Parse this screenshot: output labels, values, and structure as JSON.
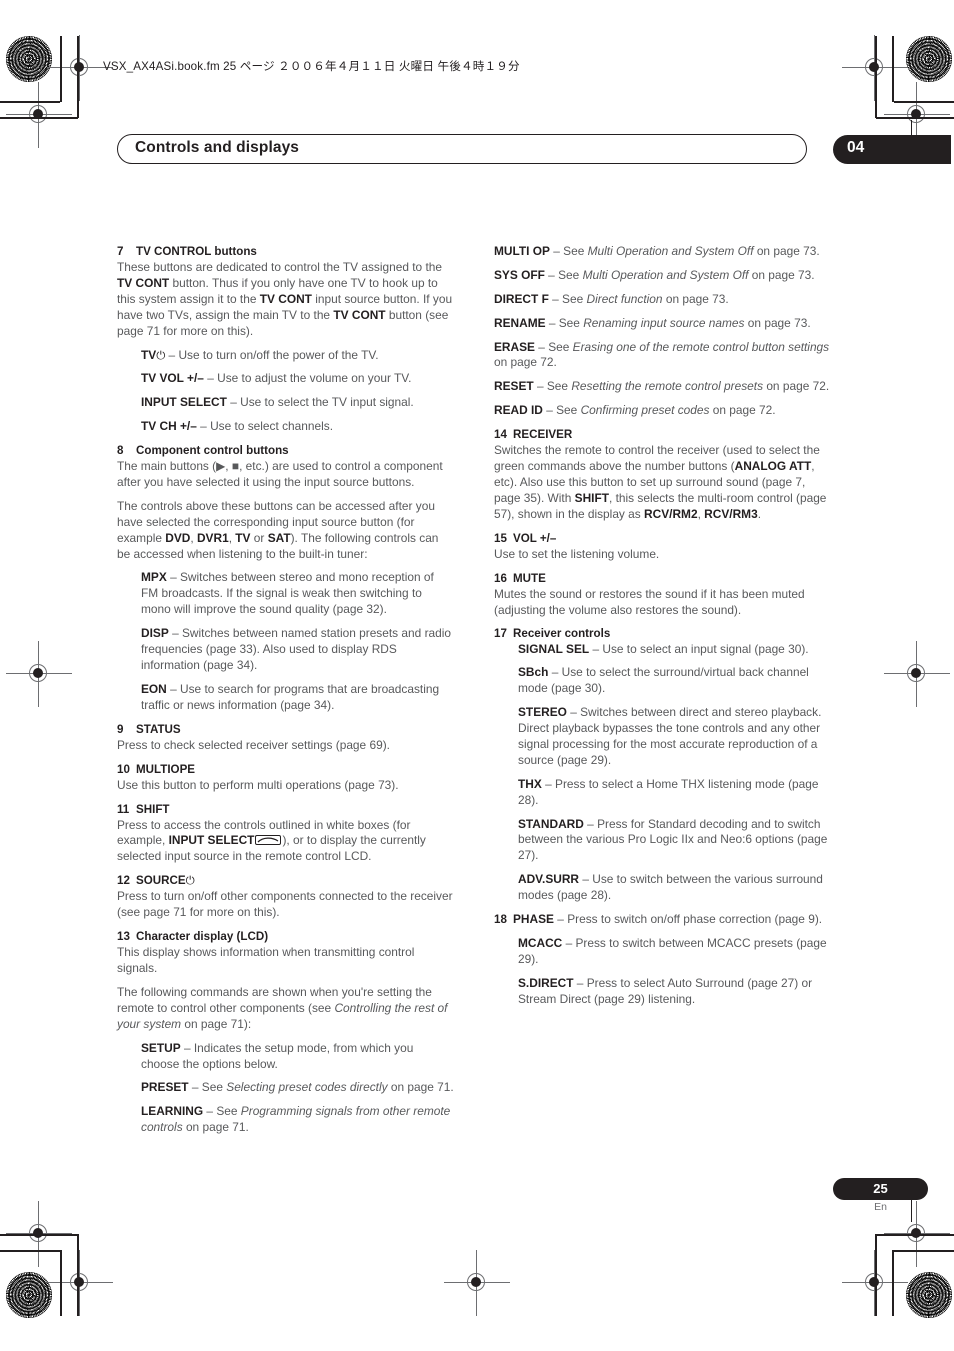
{
  "page": {
    "slug_text": "VSX_AX4ASi.book.fm 25 ページ ２００６年４月１１日  火曜日  午後４時１９分",
    "header_title": "Controls and displays",
    "chapter_number": "04",
    "page_number": "25",
    "language_code": "En",
    "accent_color": "#231f20",
    "body_color": "#58595b"
  },
  "left_column": {
    "s7": {
      "num": "7",
      "title": "TV CONTROL buttons",
      "p1_a": "These buttons are dedicated to control the TV assigned to the ",
      "p1_b": "TV CONT",
      "p1_c": " button. Thus if you only have one TV to hook up to this system assign it to the ",
      "p1_d": "TV CONT",
      "p1_e": " input source button. If you have two TVs, assign the main TV to the ",
      "p1_f": "TV CONT",
      "p1_g": " button (see page 71 for more on this).",
      "i1_label": "TV",
      "i1_text": " – Use to turn on/off the power of the TV.",
      "i2_label": "TV VOL +/–",
      "i2_text": " – Use to adjust the volume on your TV.",
      "i3_label": "INPUT SELECT",
      "i3_text": " – Use to select the TV input signal.",
      "i4_label": "TV CH +/–",
      "i4_text": " – Use to select channels."
    },
    "s8": {
      "num": "8",
      "title": "Component control buttons",
      "p1": "The main buttons (▶, ■, etc.) are used to control a component after you have selected it using the input source buttons.",
      "p2_a": "The controls above these buttons can be accessed after you have selected the corresponding input source button (for example ",
      "p2_b": "DVD",
      "p2_c": ", ",
      "p2_d": "DVR1",
      "p2_e": ", ",
      "p2_f": "TV",
      "p2_g": " or ",
      "p2_h": "SAT",
      "p2_i": "). The following controls can be accessed when listening to the built-in tuner:",
      "i1_label": "MPX",
      "i1_text": " – Switches between stereo and mono reception of FM broadcasts. If the signal is weak then switching to mono will improve the sound quality (page 32).",
      "i2_label": "DISP",
      "i2_text": " – Switches between named station presets and radio frequencies (page 33). Also used to display RDS information (page 34).",
      "i3_label": "EON",
      "i3_text": " – Use to search for programs that are broadcasting traffic or news information (page 34)."
    },
    "s9": {
      "num": "9",
      "title": "STATUS",
      "p1": "Press to check selected receiver settings (page 69)."
    },
    "s10": {
      "num": "10",
      "title": "MULTIOPE",
      "p1": "Use this button to perform multi operations (page 73)."
    },
    "s11": {
      "num": "11",
      "title": "SHIFT",
      "p1_a": "Press to access the controls outlined in white boxes (for example, ",
      "p1_b": "INPUT SELECT",
      "p1_c": "), or to display the currently selected input source in the remote control LCD."
    },
    "s12": {
      "num": "12",
      "title": "SOURCE",
      "p1": "Press to turn on/off other components connected to the receiver (see page 71 for more on this)."
    },
    "s13": {
      "num": "13",
      "title": "Character display (LCD)",
      "p1": "This display shows information when transmitting control signals.",
      "p2_a": "The following commands are shown when you're setting the remote to control other components (see ",
      "p2_b": "Controlling the rest of your system",
      "p2_c": " on page 71):",
      "i1_label": "SETUP",
      "i1_text": " – Indicates the setup mode, from which you choose the options below.",
      "i2_label": "PRESET",
      "i2_a": " – See ",
      "i2_it": "Selecting preset codes directly",
      "i2_b": " on page 71.",
      "i3_label": "LEARNING",
      "i3_a": " – See ",
      "i3_it": "Programming signals from other remote controls",
      "i3_b": " on page 71."
    }
  },
  "right_column": {
    "lcd_items": [
      {
        "label": "MULTI OP",
        "pre": " – See ",
        "italic": "Multi Operation and System Off",
        "post": " on page 73."
      },
      {
        "label": "SYS OFF",
        "pre": " – See ",
        "italic": "Multi Operation and System Off",
        "post": " on page 73."
      },
      {
        "label": "DIRECT F",
        "pre": " – See ",
        "italic": "Direct function",
        "post": " on page 73."
      },
      {
        "label": "RENAME",
        "pre": " – See ",
        "italic": "Renaming input source names",
        "post": " on page 73."
      },
      {
        "label": "ERASE",
        "pre": " – See ",
        "italic": "Erasing one of the remote control button settings",
        "post": " on page 72."
      },
      {
        "label": "RESET",
        "pre": " – See ",
        "italic": "Resetting the remote control presets",
        "post": " on page 72."
      },
      {
        "label": "READ ID",
        "pre": " – See ",
        "italic": "Confirming preset codes",
        "post": " on page 72."
      }
    ],
    "s14": {
      "num": "14",
      "title": "RECEIVER",
      "p1_a": "Switches the remote to control the receiver (used to select the green commands above the number buttons (",
      "p1_b": "ANALOG ATT",
      "p1_c": ", etc). Also use this button to set up surround sound (page 7, page 35). With ",
      "p1_d": "SHIFT",
      "p1_e": ", this selects the multi-room control (page 57), shown in the display as ",
      "p1_f": "RCV/RM2",
      "p1_g": ", ",
      "p1_h": "RCV/RM3",
      "p1_i": "."
    },
    "s15": {
      "num": "15",
      "title": "VOL +/–",
      "p1": "Use to set the listening volume."
    },
    "s16": {
      "num": "16",
      "title": "MUTE",
      "p1": "Mutes the sound or restores the sound if it has been muted (adjusting the volume also restores the sound)."
    },
    "s17": {
      "num": "17",
      "title": "Receiver controls",
      "items": [
        {
          "label": "SIGNAL SEL",
          "text": " – Use to select an input signal (page 30)."
        },
        {
          "label": "SBch",
          "text": " – Use to select the surround/virtual back channel mode (page 30)."
        },
        {
          "label": "STEREO",
          "text": " – Switches between direct and stereo playback. Direct playback bypasses the tone controls and any other signal processing for the most accurate reproduction of a source (page 29)."
        },
        {
          "label": "THX",
          "text": " – Press to select a Home THX listening mode (page 28)."
        },
        {
          "label": "STANDARD",
          "text": " – Press for Standard decoding and to switch between the various Pro Logic IIx and Neo:6 options (page 27)."
        },
        {
          "label": "ADV.SURR",
          "text": " – Use to switch between the various surround modes (page 28)."
        }
      ]
    },
    "s18": {
      "num": "18",
      "label": "PHASE",
      "text": " – Press to switch on/off phase correction (page 9).",
      "items": [
        {
          "label": "MCACC",
          "text": " – Press to switch between MCACC presets (page 29)."
        },
        {
          "label": "S.DIRECT",
          "text": " – Press to select Auto Surround (page 27) or Stream Direct (page 29) listening."
        }
      ]
    }
  }
}
